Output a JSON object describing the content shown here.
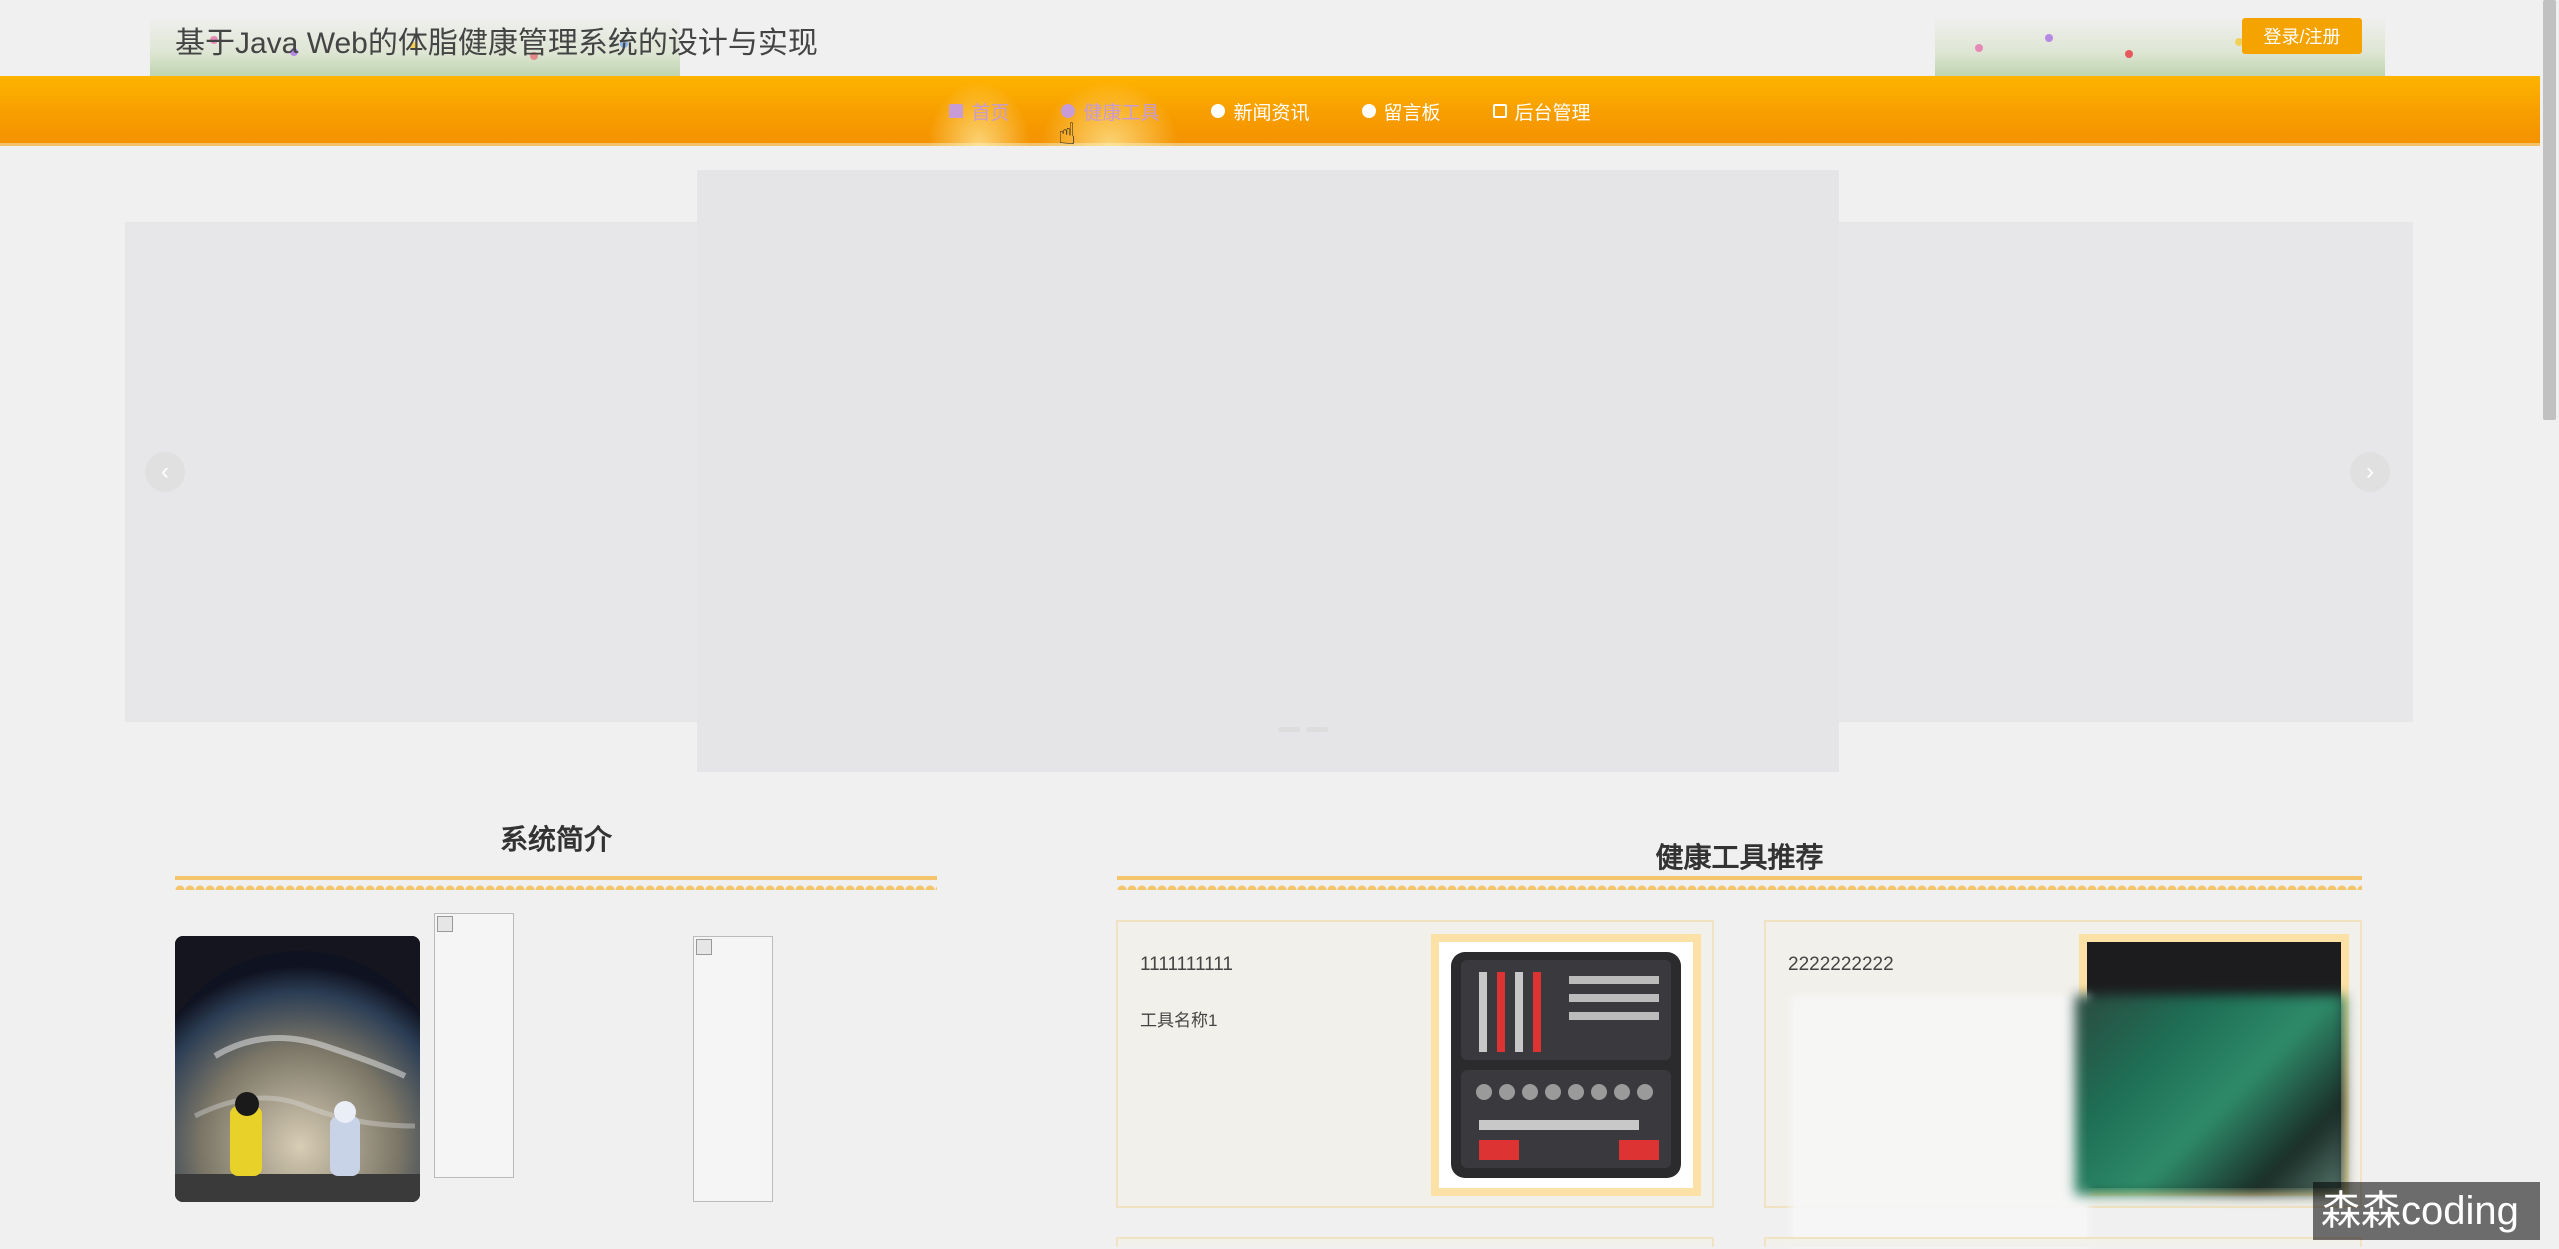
{
  "header": {
    "site_title": "基于Java Web的体脂健康管理系统的设计与实现",
    "login_label": "登录/注册"
  },
  "nav": {
    "items": [
      {
        "label": "首页",
        "icon": "home-icon",
        "state": "active"
      },
      {
        "label": "健康工具",
        "icon": "tool-icon",
        "state": "hover"
      },
      {
        "label": "新闻资讯",
        "icon": "news-icon",
        "state": "normal"
      },
      {
        "label": "留言板",
        "icon": "message-icon",
        "state": "normal"
      },
      {
        "label": "后台管理",
        "icon": "admin-icon",
        "state": "normal"
      }
    ]
  },
  "carousel": {
    "prev_symbol": "‹",
    "next_symbol": "›"
  },
  "intro": {
    "title": "系统简介"
  },
  "tools": {
    "title": "健康工具推荐",
    "cards": [
      {
        "title": "1111111111",
        "name": "工具名称1"
      },
      {
        "title": "2222222222",
        "name": ""
      }
    ]
  },
  "watermark": "森森coding",
  "colors": {
    "accent": "#f4a300",
    "nav_active_text": "#c79bd6",
    "card_border": "#f1e2c3"
  }
}
